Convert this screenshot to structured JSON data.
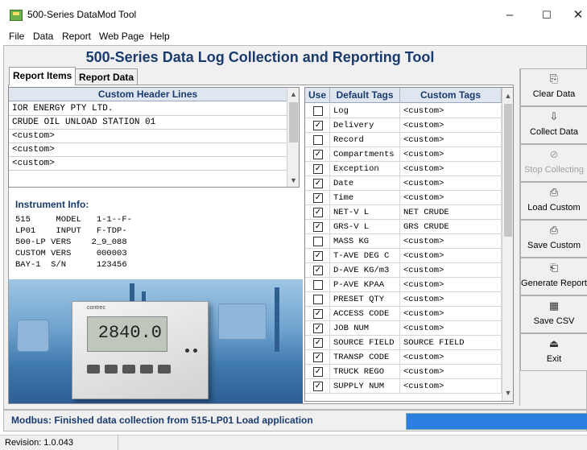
{
  "window": {
    "title": "500-Series DataMod Tool",
    "min": "–",
    "max": "☐",
    "close": "✕"
  },
  "menu": [
    "File",
    "Data",
    "Report",
    "Web Page",
    "Help"
  ],
  "headline": "500-Series Data Log Collection and Reporting Tool",
  "tabs": [
    {
      "label": "Report Items",
      "active": true
    },
    {
      "label": "Report Data",
      "active": false
    }
  ],
  "header_lines": {
    "column": "Custom Header Lines",
    "rows": [
      "IOR ENERGY PTY LTD.",
      "CRUDE OIL UNLOAD STATION 01",
      "<custom>",
      "<custom>",
      "<custom>"
    ]
  },
  "instrument": {
    "title": "Instrument Info:",
    "lines": [
      "515     MODEL   1-1--F-",
      "LP01    INPUT   F-TDP-",
      "500-LP VERS    2_9_088",
      "CUSTOM VERS     000003",
      "BAY-1  S/N      123456"
    ]
  },
  "photo": {
    "display": "2840.0",
    "brand": "contrec"
  },
  "tags": {
    "headers": [
      "Use",
      "Default Tags",
      "Custom Tags"
    ],
    "rows": [
      {
        "use": false,
        "tag": "Log",
        "custom": "<custom>"
      },
      {
        "use": true,
        "tag": "Delivery",
        "custom": "<custom>"
      },
      {
        "use": false,
        "tag": "Record",
        "custom": "<custom>"
      },
      {
        "use": true,
        "tag": "Compartments",
        "custom": "<custom>"
      },
      {
        "use": true,
        "tag": "Exception",
        "custom": "<custom>"
      },
      {
        "use": true,
        "tag": "Date",
        "custom": "<custom>"
      },
      {
        "use": true,
        "tag": "Time",
        "custom": "<custom>"
      },
      {
        "use": true,
        "tag": "NET-V  L",
        "custom": "NET CRUDE"
      },
      {
        "use": true,
        "tag": "GRS-V  L",
        "custom": "GRS CRUDE"
      },
      {
        "use": false,
        "tag": "MASS   KG",
        "custom": "<custom>"
      },
      {
        "use": true,
        "tag": "T-AVE  DEG C",
        "custom": "<custom>"
      },
      {
        "use": true,
        "tag": "D-AVE  KG/m3",
        "custom": "<custom>"
      },
      {
        "use": false,
        "tag": "P-AVE  KPAA",
        "custom": "<custom>"
      },
      {
        "use": false,
        "tag": "PRESET QTY",
        "custom": "<custom>"
      },
      {
        "use": true,
        "tag": "ACCESS CODE",
        "custom": "<custom>"
      },
      {
        "use": true,
        "tag": "JOB    NUM",
        "custom": "<custom>"
      },
      {
        "use": true,
        "tag": "SOURCE FIELD",
        "custom": "SOURCE FIELD"
      },
      {
        "use": true,
        "tag": "TRANSP CODE",
        "custom": "<custom>"
      },
      {
        "use": true,
        "tag": "TRUCK  REGO",
        "custom": "<custom>"
      },
      {
        "use": true,
        "tag": "SUPPLY NUM",
        "custom": "<custom>"
      }
    ]
  },
  "sidebar": [
    {
      "label": "Clear Data",
      "icon": "clear-icon",
      "glyph": "⎘",
      "enabled": true
    },
    {
      "label": "Collect Data",
      "icon": "collect-icon",
      "glyph": "⇩",
      "enabled": true
    },
    {
      "label": "Stop Collecting",
      "icon": "stop-icon",
      "glyph": "⊘",
      "enabled": false
    },
    {
      "label": "Load Custom",
      "icon": "load-icon",
      "glyph": "⎙",
      "enabled": true
    },
    {
      "label": "Save Custom",
      "icon": "save-icon",
      "glyph": "⎙",
      "enabled": true
    },
    {
      "label": "Generate Report",
      "icon": "report-icon",
      "glyph": "⎗",
      "enabled": true
    },
    {
      "label": "Save CSV",
      "icon": "csv-icon",
      "glyph": "▦",
      "enabled": true
    },
    {
      "label": "Exit",
      "icon": "exit-icon",
      "glyph": "⏏",
      "enabled": true
    }
  ],
  "status": {
    "message": "Modbus: Finished data collection from 515-LP01 Load application",
    "progress": 1.0
  },
  "revision": "Revision: 1.0.043",
  "colors": {
    "accent": "#1a3b6e",
    "progress": "#2b7fe0",
    "header_bg": "#dfe6f0"
  }
}
